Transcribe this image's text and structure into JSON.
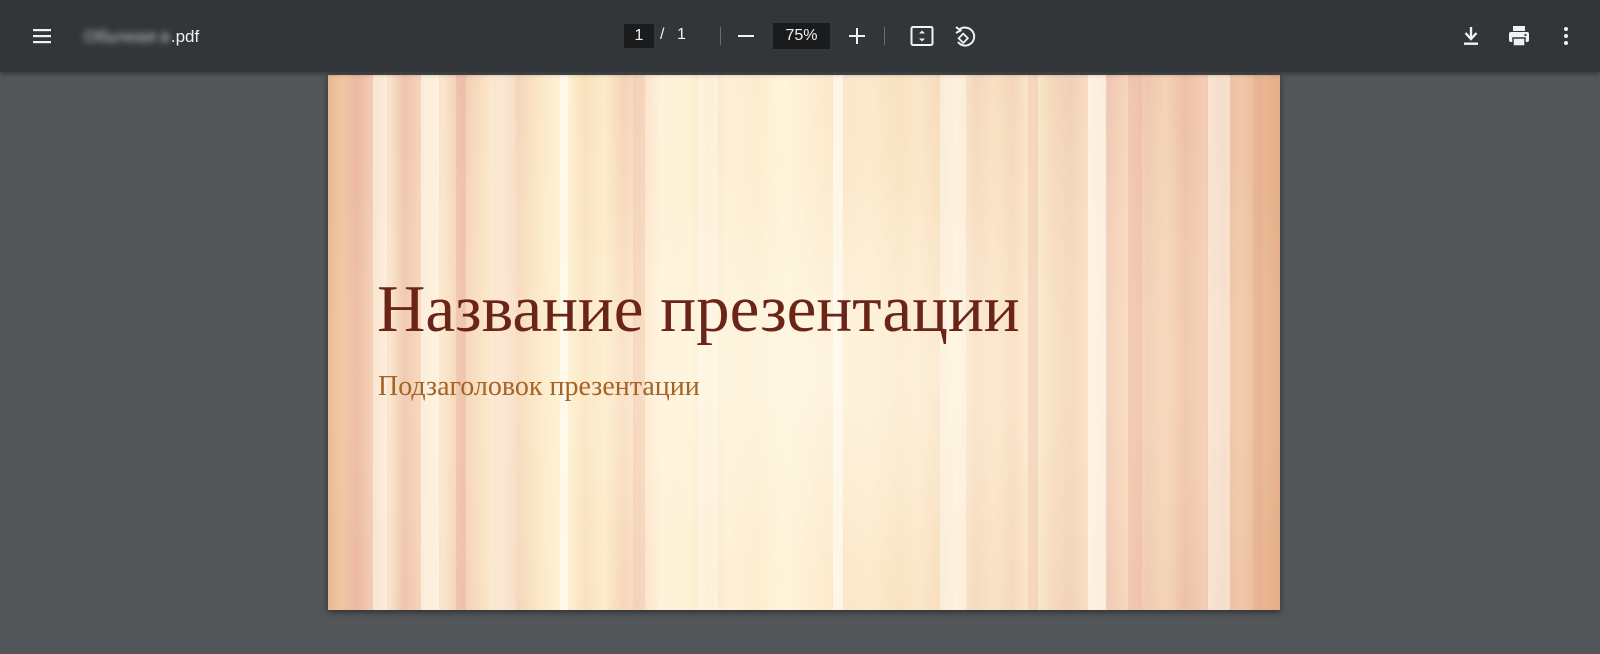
{
  "toolbar": {
    "menu_icon": "hamburger-menu-icon",
    "filename_blurred": "Обычная в",
    "filename_ext": ".pdf",
    "page_current": "1",
    "page_separator": "/",
    "page_total": "1",
    "zoom_out_icon": "minus-icon",
    "zoom_value": "75%",
    "zoom_in_icon": "plus-icon",
    "fit_icon": "fit-to-page-icon",
    "rotate_icon": "rotate-counterclockwise-icon",
    "download_icon": "download-icon",
    "print_icon": "print-icon",
    "more_icon": "more-vertical-icon"
  },
  "slide": {
    "title": "Название презентации",
    "subtitle": "Подзаголовок презентации",
    "title_color": "#6b2418",
    "subtitle_color": "#a36428"
  },
  "colors": {
    "toolbar_bg": "#323639",
    "viewer_bg": "#525659",
    "field_bg": "#191b1c",
    "icon_color": "#f1f1f1"
  }
}
